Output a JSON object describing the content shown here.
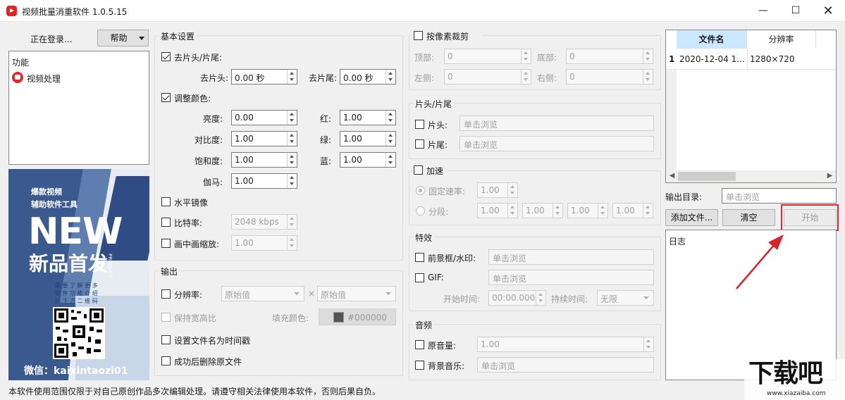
{
  "window": {
    "title": "视频批量消重软件 1.0.5.15"
  },
  "left": {
    "login_label": "正在登录...",
    "help_button": "帮助",
    "func_title": "功能",
    "func_item": "视频处理",
    "ad": {
      "line1": "爆款视频",
      "line2": "辅助软件工具",
      "big": "NEW",
      "sub": "新品首发",
      "small_en": "PRODUCT",
      "note1": "需 要 了 解 更 多",
      "note2": "软 件 功 能 介 绍",
      "note3": "扫 下 方 二 维 码",
      "wechat": "微信：kaixintaozi01"
    }
  },
  "basic": {
    "title": "基本设置",
    "trim": {
      "label": "去片头/片尾:",
      "head_label": "去片头:",
      "head_value": "0.00 秒",
      "tail_label": "去片尾:",
      "tail_value": "0.00 秒"
    },
    "color": {
      "label": "调整颜色:",
      "brightness_label": "亮度:",
      "brightness": "0.00",
      "contrast_label": "对比度:",
      "contrast": "1.00",
      "saturation_label": "饱和度:",
      "saturation": "1.00",
      "gamma_label": "伽马:",
      "gamma": "1.00",
      "red_label": "红:",
      "red": "1.00",
      "green_label": "绿:",
      "green": "1.00",
      "blue_label": "蓝:",
      "blue": "1.00"
    },
    "mirror_label": "水平镜像",
    "bitrate_label": "比特率:",
    "bitrate_value": "2048 kbps",
    "pip_label": "画中画缩放:",
    "pip_value": "1.00"
  },
  "output": {
    "title": "输出",
    "resolution_label": "分辨率:",
    "res_w": "原始值",
    "res_x": "×",
    "res_h": "原始值",
    "keep_ratio_label": "保持宽高比",
    "fill_label": "填充颜色:",
    "fill_value": "#000000",
    "fill_color": "#555555",
    "timestamp_label": "设置文件名为时间戳",
    "delete_label": "成功后删除原文件"
  },
  "crop": {
    "title": "按像素裁剪",
    "top_label": "顶部:",
    "top": "0",
    "bottom_label": "底部:",
    "bottom": "0",
    "left_label": "左侧:",
    "left": "0",
    "right_label": "右侧:",
    "right": "0"
  },
  "headtail": {
    "title": "片头/片尾",
    "head_label": "片头:",
    "head_placeholder": "单击浏览",
    "tail_label": "片尾:",
    "tail_placeholder": "单击浏览"
  },
  "speed": {
    "title": "加速",
    "fixed_label": "固定速率:",
    "fixed_value": "1.00",
    "seg_label": "分段:",
    "seg_values": [
      "1.00",
      "1.00",
      "1.00",
      "1.00"
    ]
  },
  "effects": {
    "title": "特效",
    "frame_label": "前景框/水印:",
    "frame_placeholder": "单击浏览",
    "gif_label": "GIF:",
    "gif_placeholder": "单击浏览",
    "start_label": "开始时间:",
    "start_value": "00:00.000",
    "duration_label": "持续时间:",
    "duration_value": "无限"
  },
  "audio": {
    "title": "音频",
    "orig_label": "原音量:",
    "orig_value": "1.00",
    "bgm_label": "背景音乐:",
    "bgm_placeholder": "单击浏览"
  },
  "files": {
    "columns": [
      "文件名",
      "分辨率"
    ],
    "rows": [
      {
        "index": "1",
        "name": "2020-12-04 1...",
        "res": "1280×720"
      }
    ]
  },
  "right": {
    "output_dir_label": "输出目录:",
    "output_dir_placeholder": "单击浏览",
    "add_button": "添加文件...",
    "clear_button": "清空",
    "start_button": "开始",
    "log_title": "日志"
  },
  "status": "本软件使用范围仅限于对自己原创作品多次编辑处理。请遵守相关法律使用本软件，否则后果自负。",
  "watermark": {
    "brand": "下载吧",
    "url": "www.xiazaiba.com"
  },
  "colors": {
    "highlight": "#e0262c",
    "arrow": "#d8232a"
  }
}
